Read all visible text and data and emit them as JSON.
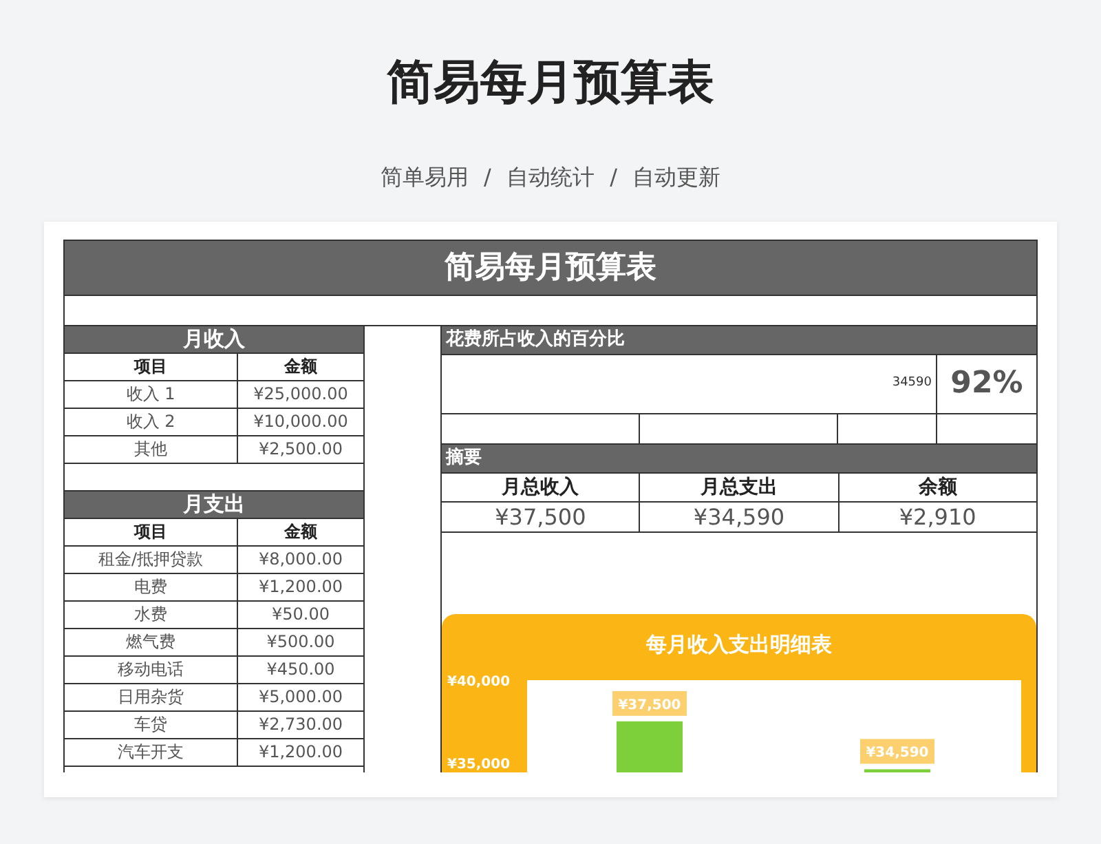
{
  "page": {
    "title": "简易每月预算表",
    "subtitle": "简单易用 / 自动统计 / 自动更新"
  },
  "sheet": {
    "title": "简易每月预算表",
    "income": {
      "title": "月收入",
      "columns": [
        "项目",
        "金额"
      ],
      "rows": [
        [
          "收入 1",
          "¥25,000.00"
        ],
        [
          "收入 2",
          "¥10,000.00"
        ],
        [
          "其他",
          "¥2,500.00"
        ]
      ]
    },
    "expenses": {
      "title": "月支出",
      "columns": [
        "项目",
        "金额"
      ],
      "rows": [
        [
          "租金/抵押贷款",
          "¥8,000.00"
        ],
        [
          "电费",
          "¥1,200.00"
        ],
        [
          "水费",
          "¥50.00"
        ],
        [
          "燃气费",
          "¥500.00"
        ],
        [
          "移动电话",
          "¥450.00"
        ],
        [
          "日用杂货",
          "¥5,000.00"
        ],
        [
          "车贷",
          "¥2,730.00"
        ],
        [
          "汽车开支",
          "¥1,200.00"
        ]
      ]
    },
    "percent": {
      "title": "花费所占收入的百分比",
      "expense_total": "34590",
      "percent": "92%"
    },
    "summary": {
      "title": "摘要",
      "columns": [
        "月总收入",
        "月总支出",
        "余额"
      ],
      "values": [
        "¥37,500",
        "¥34,590",
        "¥2,910"
      ]
    },
    "chart": {
      "chart_data": {
        "type": "bar",
        "title": "每月收入支出明细表",
        "series": [
          {
            "color": "#7ed03a",
            "values": [
              37500,
              34590
            ]
          }
        ],
        "ylim": [
          34400,
          40000
        ],
        "yticks": [
          {
            "value": 35000,
            "label": "¥35,000"
          },
          {
            "value": 40000,
            "label": "¥40,000"
          }
        ],
        "value_labels": [
          "¥37,500",
          "¥34,590"
        ]
      }
    }
  }
}
